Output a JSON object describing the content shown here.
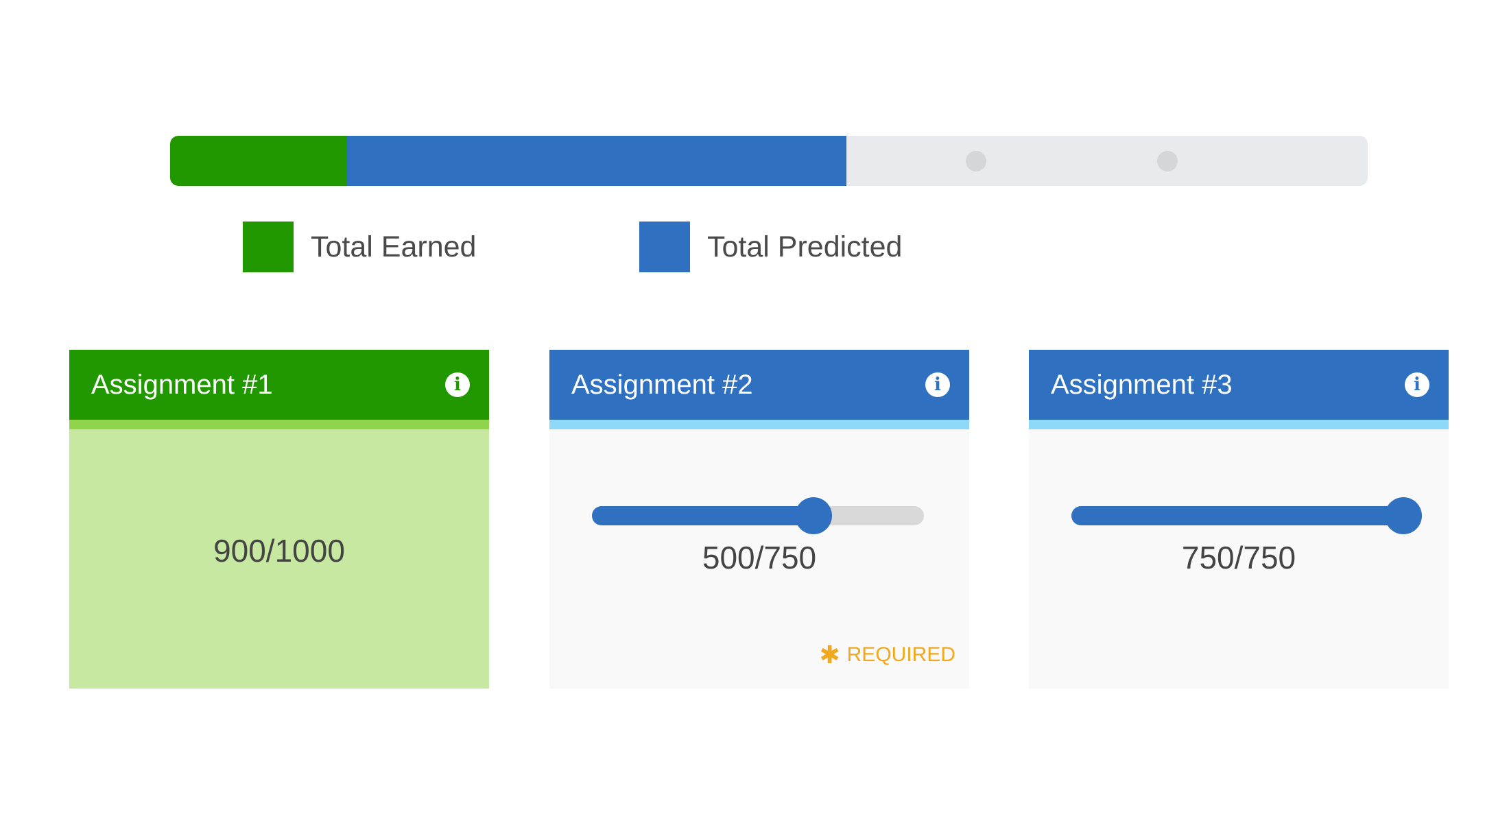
{
  "colors": {
    "earned": "#229800",
    "earned_stripe": "#8fd44a",
    "earned_body": "#c7e8a0",
    "predicted": "#2f71c0",
    "predicted_stripe": "#8ed8f8",
    "track": "#e8eaed",
    "required": "#f2a81d"
  },
  "progress": {
    "earned_fraction": 0.148,
    "predicted_fraction": 0.565,
    "ticks": [
      0.673,
      0.833
    ]
  },
  "legend": {
    "earned_label": "Total Earned",
    "predicted_label": "Total Predicted"
  },
  "cards": [
    {
      "title": "Assignment #1",
      "score": "900/1000",
      "status": "earned",
      "info_icon": "info-icon"
    },
    {
      "title": "Assignment #2",
      "score": "500/750",
      "status": "predicted",
      "slider_fraction": 0.667,
      "required_label": "REQUIRED",
      "info_icon": "info-icon"
    },
    {
      "title": "Assignment #3",
      "score": "750/750",
      "status": "predicted",
      "slider_fraction": 1.0,
      "info_icon": "info-icon"
    }
  ]
}
